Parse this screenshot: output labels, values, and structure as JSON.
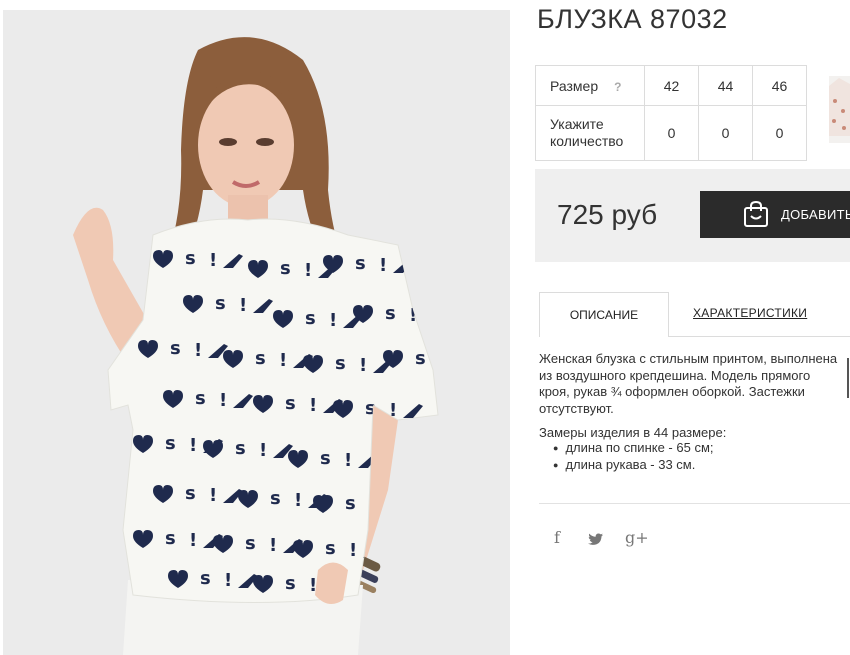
{
  "product": {
    "title": "БЛУЗКА 87032",
    "size_label": "Размер",
    "size_help": "?",
    "sizes": [
      "42",
      "44",
      "46"
    ],
    "qty_label": "Укажите количество",
    "quantities": [
      "0",
      "0",
      "0"
    ],
    "price": "725 руб",
    "add_button": "ДОБАВИТЬ"
  },
  "tabs": {
    "description": "ОПИСАНИЕ",
    "characteristics": "ХАРАКТЕРИСТИКИ"
  },
  "description": {
    "text": "Женская блузка с стильным принтом, выполнена из воздушного крепдешина. Модель прямого кроя, рукав ¾ оформлен оборкой. Застежки отсутствуют.",
    "measurements_heading": "Замеры изделия в 44 размере:",
    "measurements": [
      "длина по спинке - 65 см;",
      "длина рукава - 33 см."
    ]
  },
  "social": {
    "facebook": "f",
    "twitter": "twitter-icon",
    "googleplus": "g+"
  },
  "icons": {
    "cart": "shopping-bag-icon",
    "help": "question-icon"
  },
  "colors": {
    "button_bg": "#2b2b2b",
    "price_box_bg": "#efefef",
    "photo_bg": "#ebebeb",
    "print_navy": "#1f2a4d"
  }
}
